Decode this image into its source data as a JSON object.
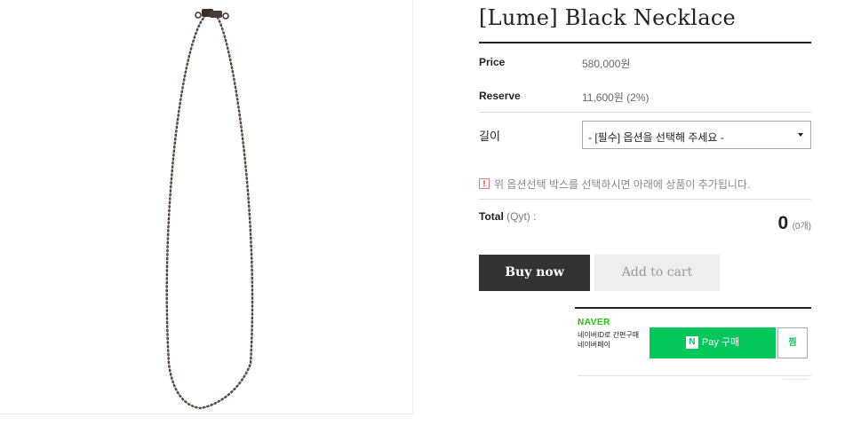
{
  "product": {
    "title": "[Lume] Black Necklace",
    "price_label": "Price",
    "price_value": "580,000원",
    "reserve_label": "Reserve",
    "reserve_value": "11,600원 (2%)"
  },
  "option": {
    "label": "길이",
    "select_value": "- [필수] 옵션을 선택해 주세요 -"
  },
  "notice": {
    "icon": "!",
    "text": "위 옵션선택 박스를 선택하시면 아래에 상품이 추가됩니다."
  },
  "total": {
    "label": "Total",
    "qyt": "(Qyt) :",
    "value": "0",
    "count": "(0개)"
  },
  "buttons": {
    "buy_now": "Buy now",
    "add_to_cart": "Add to cart"
  },
  "naver_pay": {
    "brand": "NAVER",
    "desc_line1": "네이버ID로 간편구매",
    "desc_line2": "네이버페이",
    "logo_letter": "N",
    "pay_label": "Pay 구매",
    "wish_label": "찜",
    "brand_color": "#03c75a"
  },
  "colors": {
    "buy_button": "#333333",
    "cart_button": "#eeeeee"
  }
}
